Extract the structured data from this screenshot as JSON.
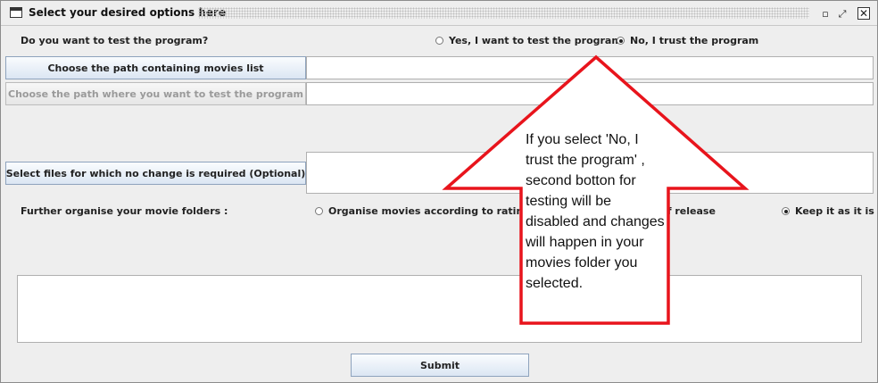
{
  "window": {
    "title": "Select your desired options here",
    "icons": [
      "window-icon",
      "restore-icon",
      "maximize-icon",
      "close-icon"
    ],
    "min_glyph": "▫",
    "max_glyph": "⤢",
    "close_glyph": "✕"
  },
  "test_question": {
    "label": "Do you want to test the program?",
    "options": [
      {
        "label": "Yes, I want to test the program",
        "selected": false
      },
      {
        "label": "No, I trust the program",
        "selected": true
      }
    ]
  },
  "movies_path": {
    "button_label": "Choose the path containing movies list",
    "value": ""
  },
  "test_path": {
    "button_label": "Choose the path where you want to test the program",
    "value": "",
    "enabled": false
  },
  "no_change": {
    "button_label": "Select files for which no change is required (Optional)",
    "value": ""
  },
  "organise": {
    "label": "Further organise your movie folders :",
    "options": [
      {
        "label": "Organise movies according to rating",
        "selected": false
      },
      {
        "label": "Organise movies according to date of release",
        "visible_label": "g to date of release",
        "selected": false
      },
      {
        "label": "Keep it as it is",
        "selected": true
      }
    ]
  },
  "output": {
    "value": ""
  },
  "submit": {
    "label": "Submit"
  },
  "annotation": {
    "text": "If you select 'No, I trust the program' , second botton for testing will be disabled and changes will happen in your movies folder you selected.",
    "arrow_color": "#e8141c"
  }
}
